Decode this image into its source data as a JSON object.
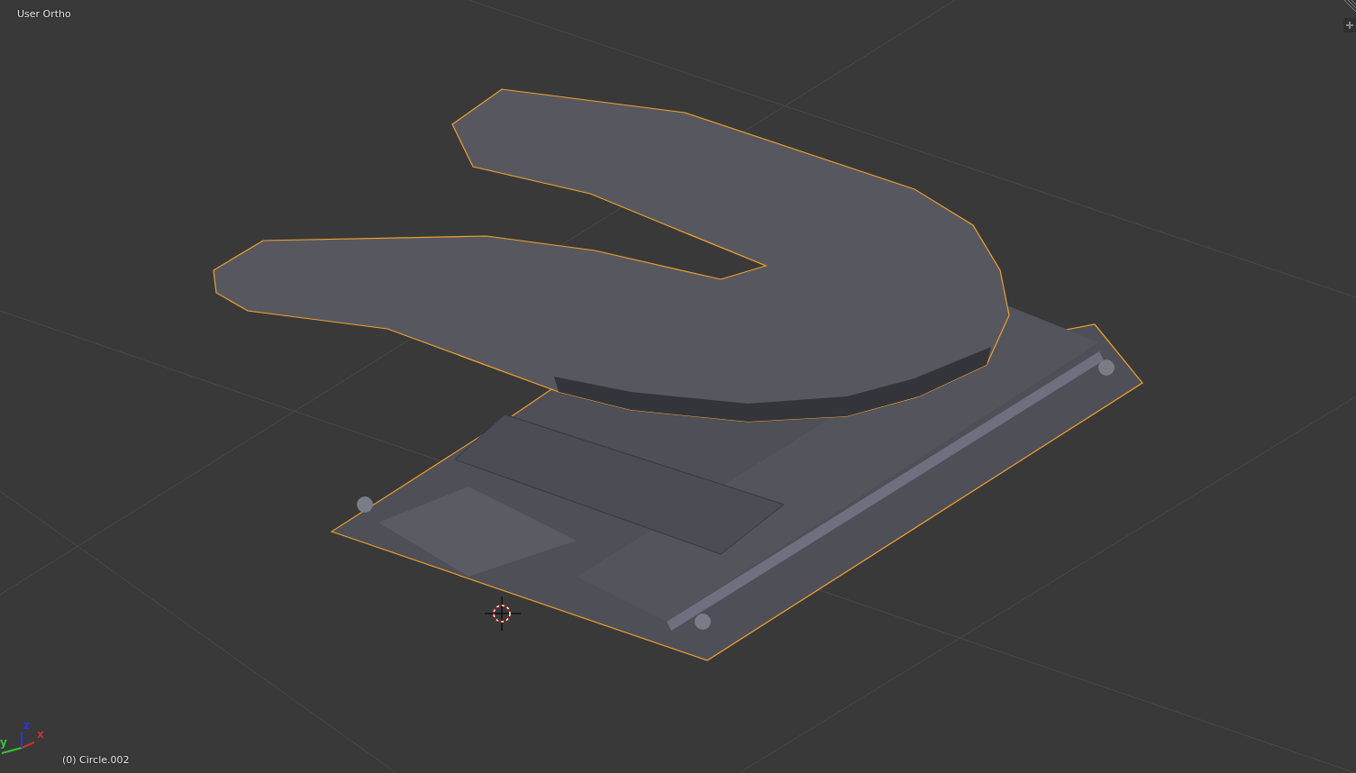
{
  "viewport": {
    "view_name": "User Ortho",
    "object_label": "(0) Circle.002",
    "axes": [
      {
        "label": "x",
        "color": "#c83232"
      },
      {
        "label": "y",
        "color": "#32c832"
      },
      {
        "label": "z",
        "color": "#3232e6"
      }
    ]
  }
}
